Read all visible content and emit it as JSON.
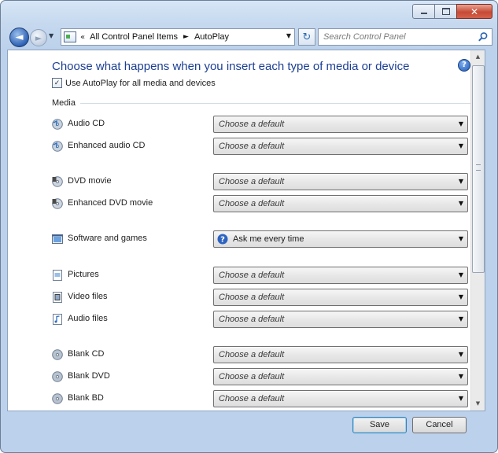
{
  "window": {
    "title": "",
    "caption": {
      "minimize_icon": "minimize-icon",
      "maximize_icon": "maximize-icon",
      "close_glyph": "✕"
    }
  },
  "nav": {
    "back_glyph": "◄",
    "forward_glyph": "►",
    "history_glyph": "▼",
    "address": {
      "chevron": "«",
      "breadcrumbs": [
        "All Control Panel Items",
        "AutoPlay"
      ],
      "separator": "►",
      "dropdown_glyph": "▼"
    },
    "refresh_glyph": "↻",
    "search": {
      "placeholder": "Search Control Panel"
    }
  },
  "content": {
    "help_glyph": "?",
    "heading": "Choose what happens when you insert each type of media or device",
    "use_autoplay": {
      "label": "Use AutoPlay for all media and devices",
      "checked": true,
      "check_glyph": "✓"
    },
    "section_title": "Media",
    "rows": [
      {
        "label": "Audio CD",
        "value": "Choose a default",
        "icon": "audio-cd-icon"
      },
      {
        "label": "Enhanced audio CD",
        "value": "Choose a default",
        "icon": "enhanced-audio-cd-icon"
      },
      {
        "label": "DVD movie",
        "value": "Choose a default",
        "icon": "dvd-movie-icon"
      },
      {
        "label": "Enhanced DVD movie",
        "value": "Choose a default",
        "icon": "enhanced-dvd-movie-icon"
      },
      {
        "label": "Software and games",
        "value": "Ask me every time",
        "icon": "software-games-icon"
      },
      {
        "label": "Pictures",
        "value": "Choose a default",
        "icon": "pictures-icon"
      },
      {
        "label": "Video files",
        "value": "Choose a default",
        "icon": "video-files-icon"
      },
      {
        "label": "Audio files",
        "value": "Choose a default",
        "icon": "audio-files-icon"
      },
      {
        "label": "Blank CD",
        "value": "Choose a default",
        "icon": "blank-cd-icon"
      },
      {
        "label": "Blank DVD",
        "value": "Choose a default",
        "icon": "blank-dvd-icon"
      },
      {
        "label": "Blank BD",
        "value": "Choose a default",
        "icon": "blank-bd-icon"
      }
    ],
    "select_arrow": "▼"
  },
  "scrollbar": {
    "up_glyph": "▲",
    "down_glyph": "▼"
  },
  "footer": {
    "save_label": "Save",
    "cancel_label": "Cancel"
  },
  "colors": {
    "heading": "#1c3f94",
    "frame": "#bcd1eb",
    "close": "#c74a36"
  }
}
